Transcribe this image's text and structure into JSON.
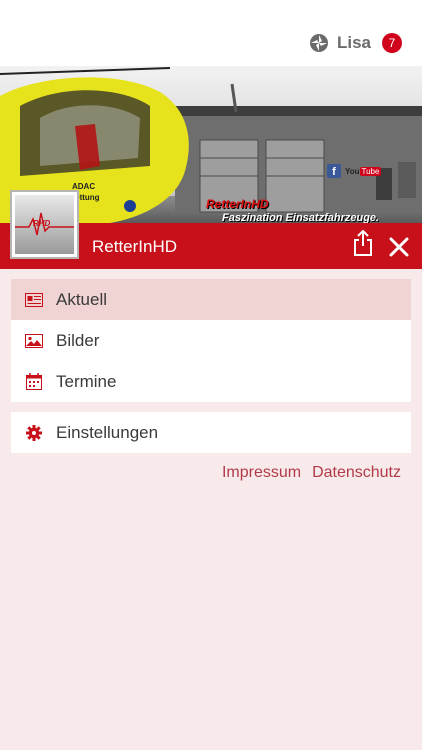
{
  "user": {
    "name": "Lisa",
    "badge_count": "7"
  },
  "hero": {
    "title": "RetterInHD",
    "subtitle": "Faszination Einsatzfahrzeuge.",
    "facebook": "f",
    "youtube_prefix": "You",
    "youtube_suffix": "Tube",
    "heli_text_1": "ADAC",
    "heli_text_2": "rettung"
  },
  "app": {
    "title": "RetterInHD",
    "logo_text": "RHD"
  },
  "menu": {
    "items": [
      {
        "label": "Aktuell",
        "icon": "newspaper-icon",
        "active": true
      },
      {
        "label": "Bilder",
        "icon": "image-icon",
        "active": false
      },
      {
        "label": "Termine",
        "icon": "calendar-icon",
        "active": false
      }
    ],
    "settings": {
      "label": "Einstellungen",
      "icon": "gear-icon"
    }
  },
  "footer": {
    "impressum": "Impressum",
    "datenschutz": "Datenschutz"
  },
  "colors": {
    "brand_red": "#c8101a",
    "badge_red": "#d0021b",
    "link": "#b23a48",
    "background": "#f8eaea",
    "active_item": "#f0d3d3"
  }
}
